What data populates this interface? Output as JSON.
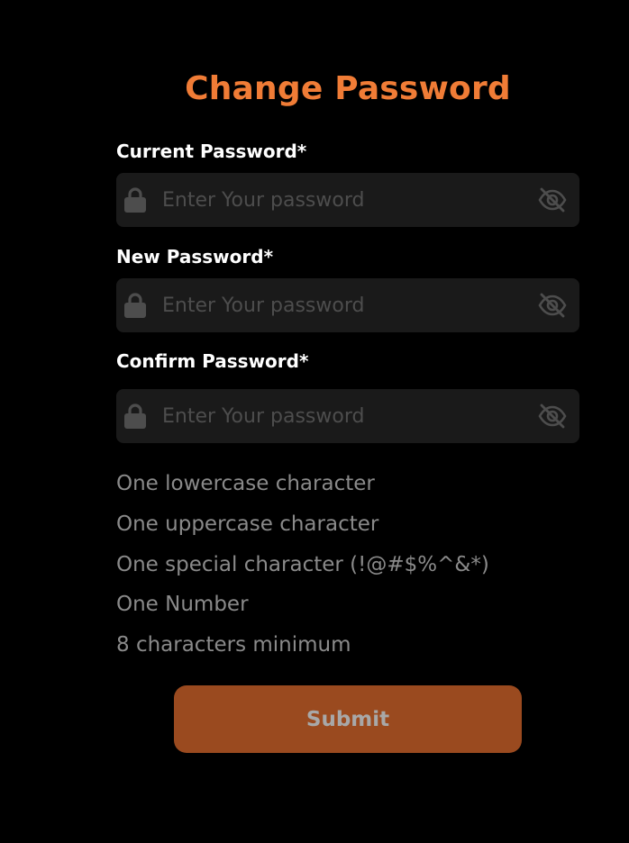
{
  "title": "Change Password",
  "colors": {
    "accent": "#f07c36",
    "button_bg": "#9a4a1f",
    "field_bg": "#1a1a1a",
    "icon": "#4d4d4d"
  },
  "fields": [
    {
      "label": "Current Password*",
      "placeholder": "Enter Your password",
      "value": "",
      "lock_icon": "lock-icon",
      "toggle_icon": "eye-off-icon"
    },
    {
      "label": "New Password*",
      "placeholder": "Enter Your password",
      "value": "",
      "lock_icon": "lock-icon",
      "toggle_icon": "eye-off-icon"
    },
    {
      "label": "Confirm Password*",
      "placeholder": "Enter Your password",
      "value": "",
      "lock_icon": "lock-icon",
      "toggle_icon": "eye-off-icon"
    }
  ],
  "rules": [
    "One lowercase character",
    "One uppercase character",
    "One special character (!@#$%^&*)",
    "One Number",
    "8 characters minimum"
  ],
  "submit_label": "Submit"
}
